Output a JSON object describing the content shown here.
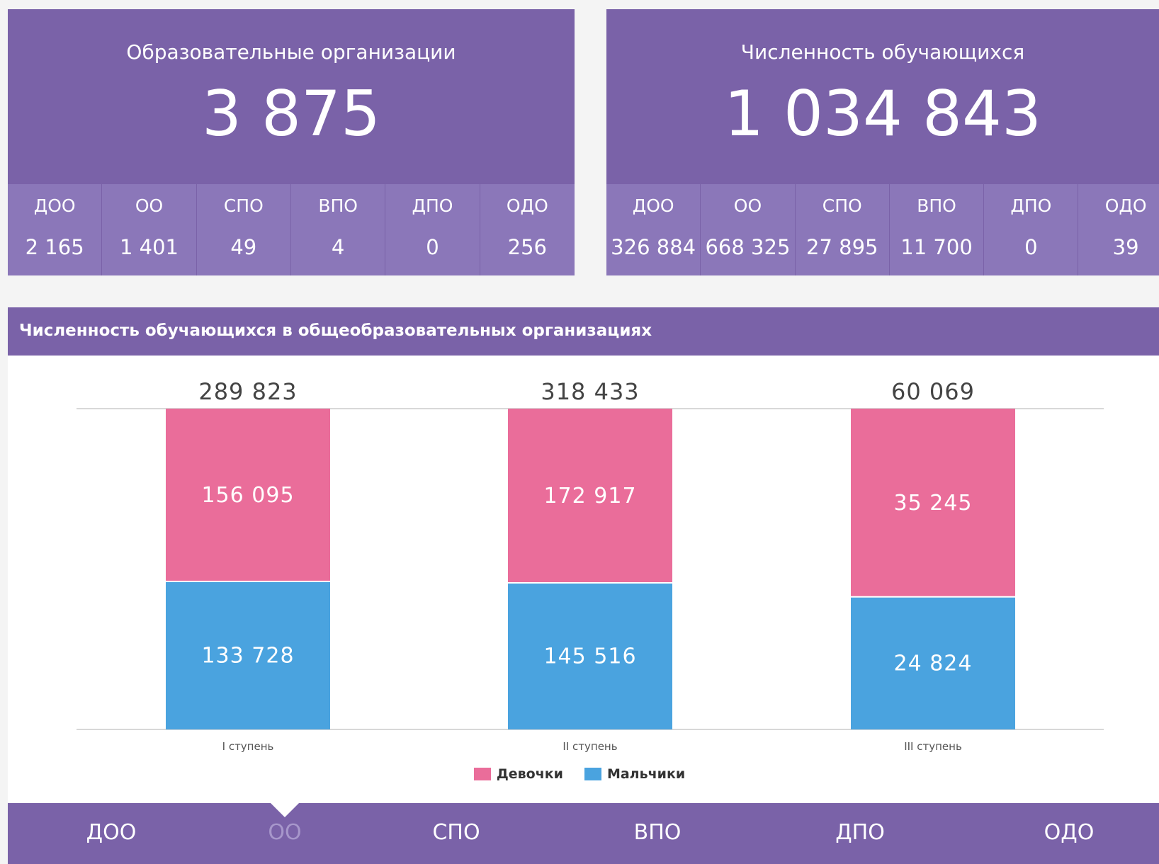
{
  "cards": {
    "orgs": {
      "title": "Образовательные организации",
      "total": "3 875",
      "items": [
        {
          "label": "ДОО",
          "value": "2 165"
        },
        {
          "label": "ОО",
          "value": "1 401"
        },
        {
          "label": "СПО",
          "value": "49"
        },
        {
          "label": "ВПО",
          "value": "4"
        },
        {
          "label": "ДПО",
          "value": "0"
        },
        {
          "label": "ОДО",
          "value": "256"
        }
      ]
    },
    "students": {
      "title": "Численность обучающихся",
      "total": "1 034 843",
      "items": [
        {
          "label": "ДОО",
          "value": "326 884"
        },
        {
          "label": "ОО",
          "value": "668 325"
        },
        {
          "label": "СПО",
          "value": "27 895"
        },
        {
          "label": "ВПО",
          "value": "11 700"
        },
        {
          "label": "ДПО",
          "value": "0"
        },
        {
          "label": "ОДО",
          "value": "39"
        }
      ]
    }
  },
  "panel": {
    "title": "Численность обучающихся в общеобразовательных организациях"
  },
  "chart_data": {
    "type": "bar",
    "stacked": true,
    "categories": [
      "I ступень",
      "II ступень",
      "III ступень"
    ],
    "totals": [
      289823,
      318433,
      60069
    ],
    "totals_labels": [
      "289 823",
      "318 433",
      "60 069"
    ],
    "series": [
      {
        "name": "Мальчики",
        "color": "#4aa3df",
        "values": [
          133728,
          145516,
          24824
        ],
        "labels": [
          "133 728",
          "145 516",
          "24 824"
        ]
      },
      {
        "name": "Девочки",
        "color": "#ea6d9a",
        "values": [
          156095,
          172917,
          35245
        ],
        "labels": [
          "156 095",
          "172 917",
          "35 245"
        ]
      }
    ],
    "legend_position": "bottom-center",
    "grid": false
  },
  "legend": {
    "girls": "Девочки",
    "boys": "Мальчики"
  },
  "tabs": {
    "items": [
      "ДОО",
      "ОО",
      "СПО",
      "ВПО",
      "ДПО",
      "ОДО"
    ],
    "active": 1
  },
  "colors": {
    "purple": "#7a62a8",
    "purple_light": "#8b77b9",
    "pink": "#ea6d9a",
    "blue": "#4aa3df"
  }
}
